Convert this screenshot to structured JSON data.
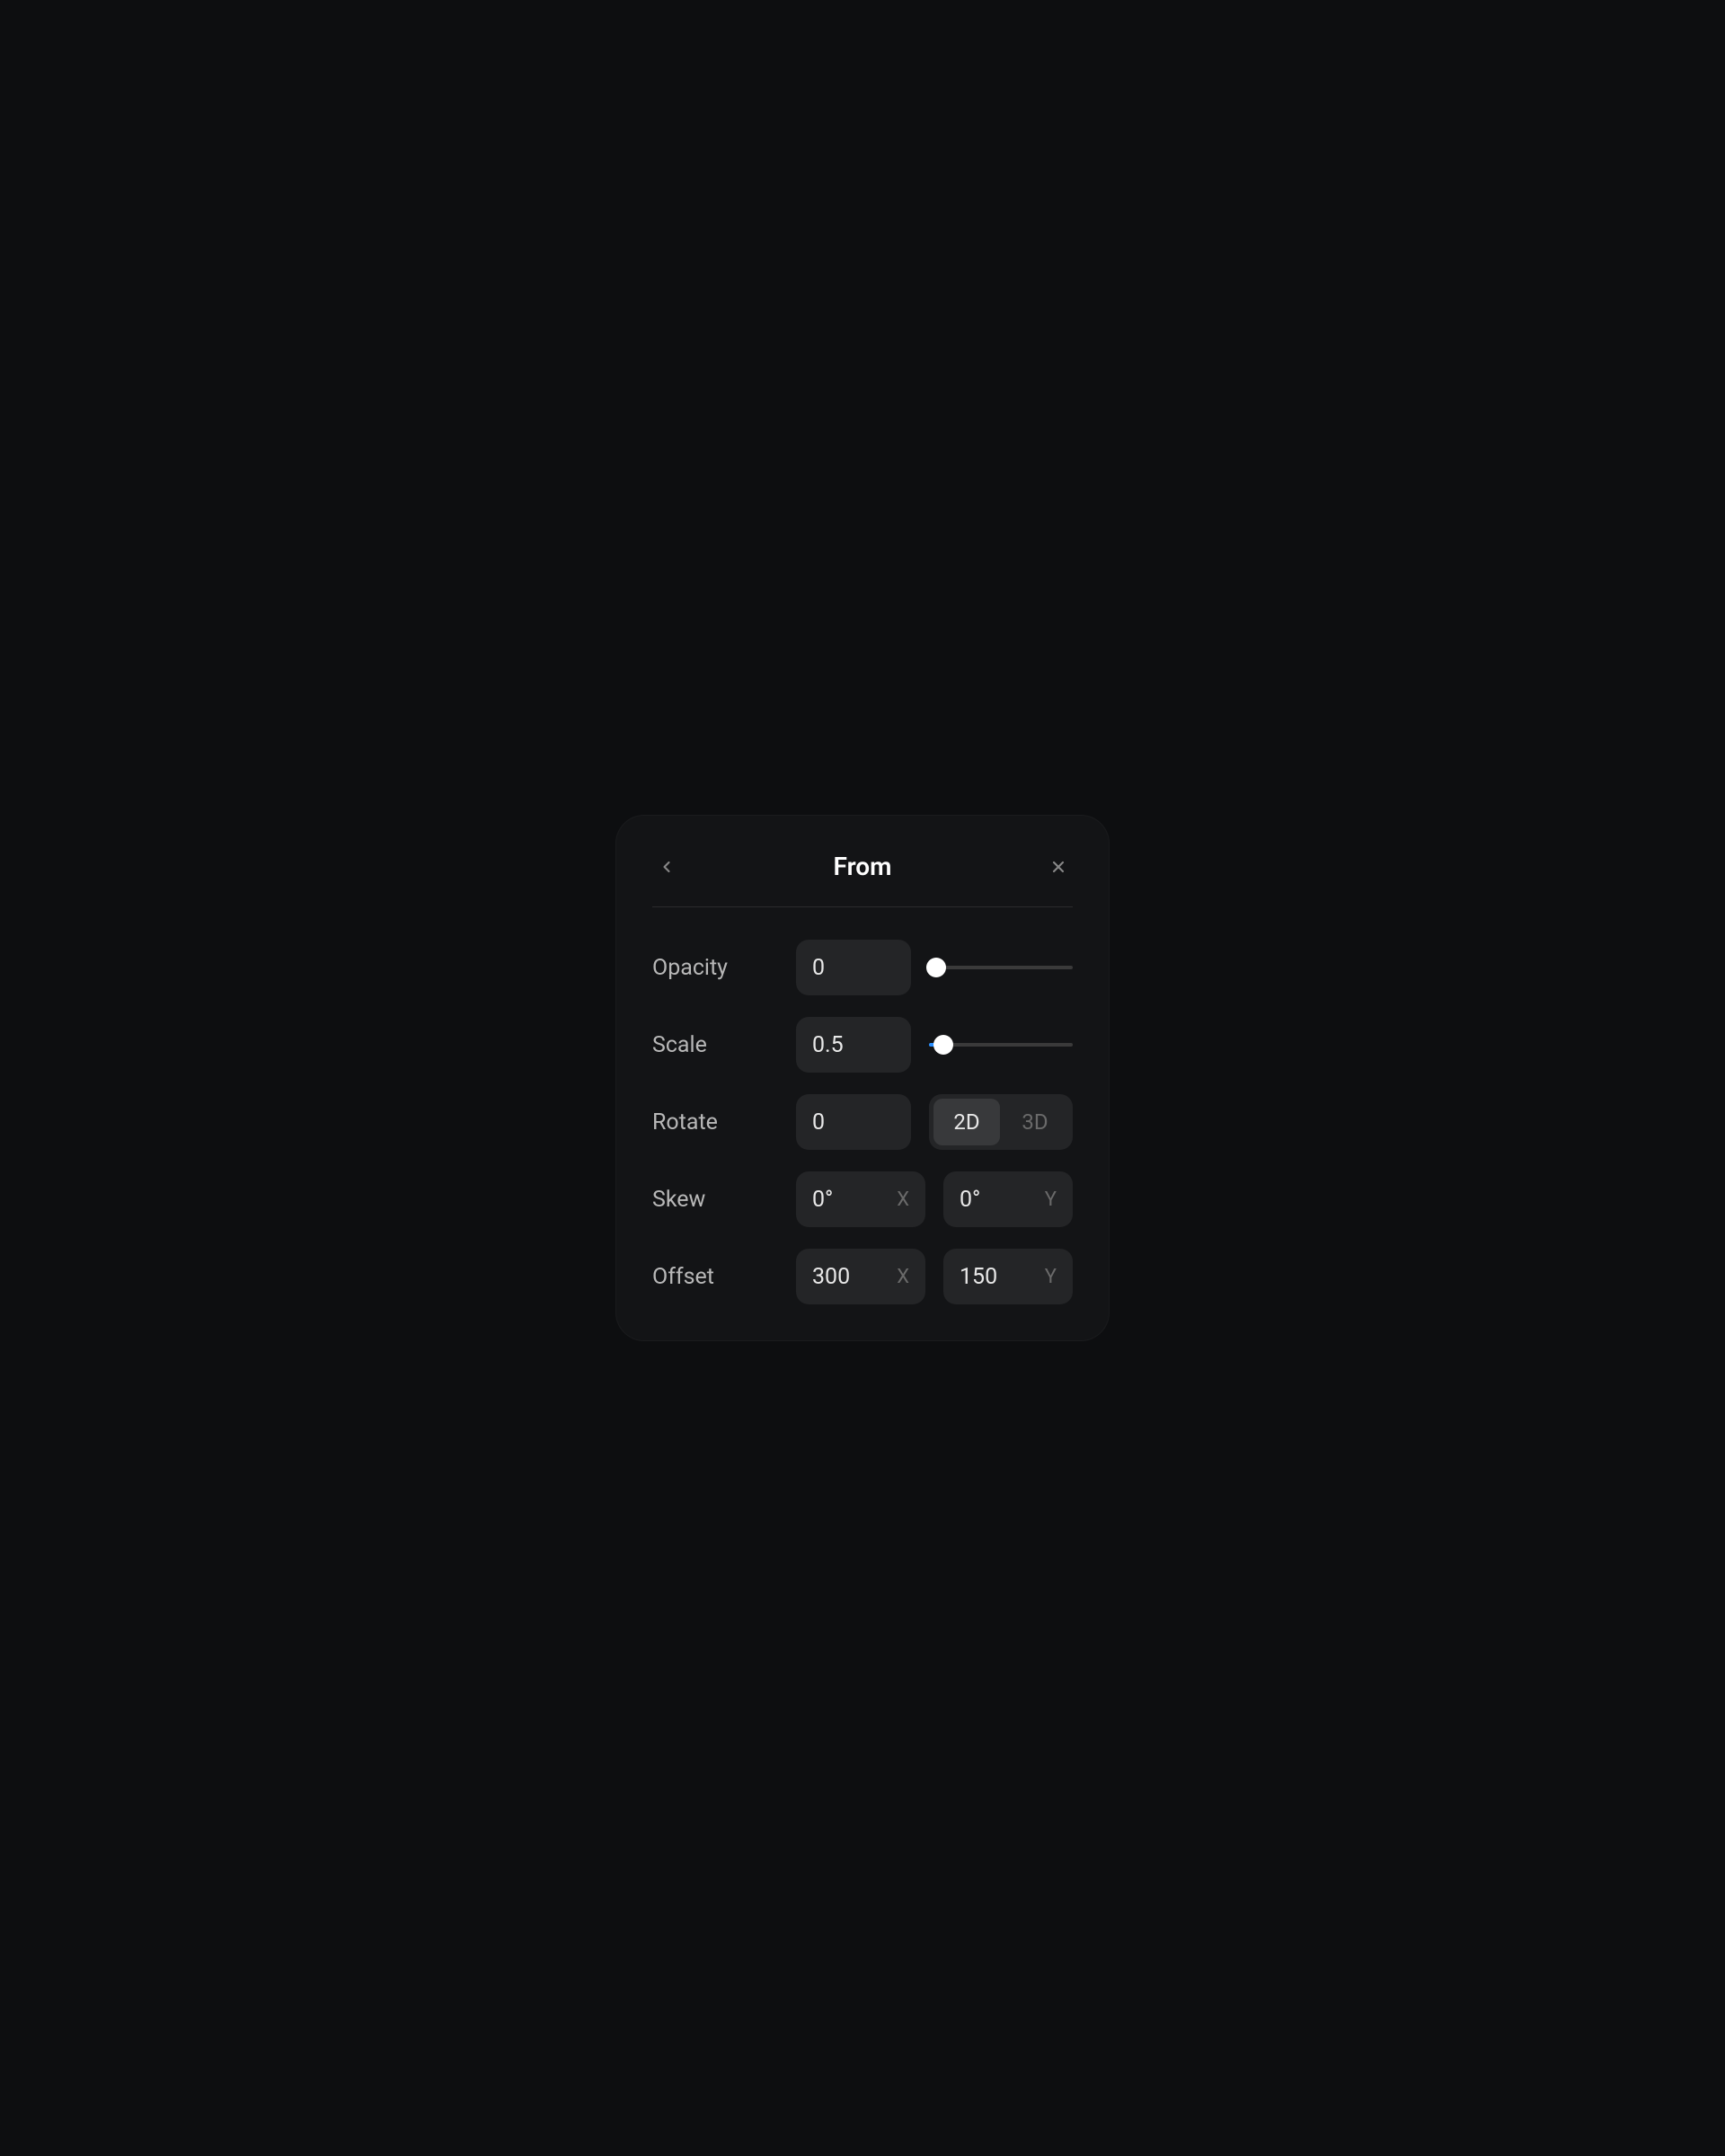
{
  "header": {
    "title": "From"
  },
  "rows": {
    "opacity": {
      "label": "Opacity",
      "value": "0",
      "sliderPercent": 5
    },
    "scale": {
      "label": "Scale",
      "value": "0.5",
      "sliderPercent": 10
    },
    "rotate": {
      "label": "Rotate",
      "value": "0",
      "mode2d": "2D",
      "mode3d": "3D"
    },
    "skew": {
      "label": "Skew",
      "x": "0°",
      "y": "0°",
      "xSuffix": "X",
      "ySuffix": "Y"
    },
    "offset": {
      "label": "Offset",
      "x": "300",
      "y": "150",
      "xSuffix": "X",
      "ySuffix": "Y"
    }
  }
}
